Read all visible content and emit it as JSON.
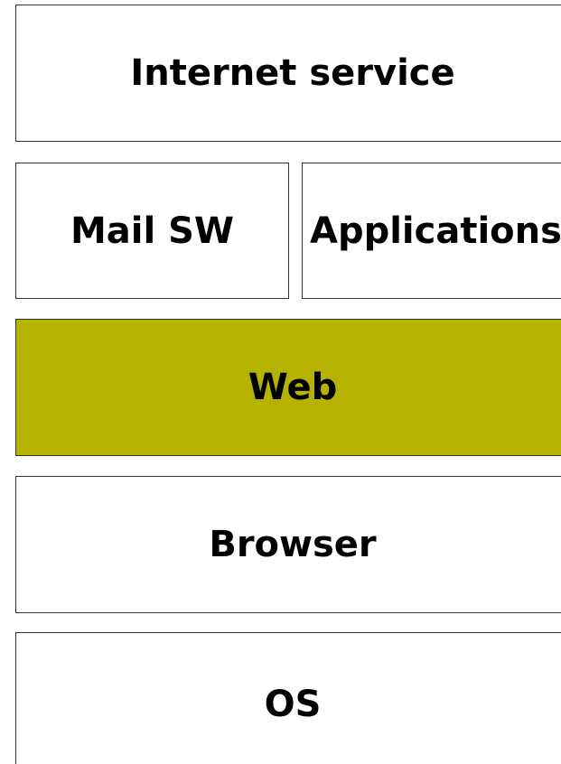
{
  "layers": {
    "internet_service": "Internet service",
    "mail_sw": "Mail SW",
    "applications": "Applications",
    "web": "Web",
    "browser": "Browser",
    "os": "OS"
  },
  "colors": {
    "highlight": "#b5b300",
    "box": "#ffffff",
    "border": "#333333"
  }
}
